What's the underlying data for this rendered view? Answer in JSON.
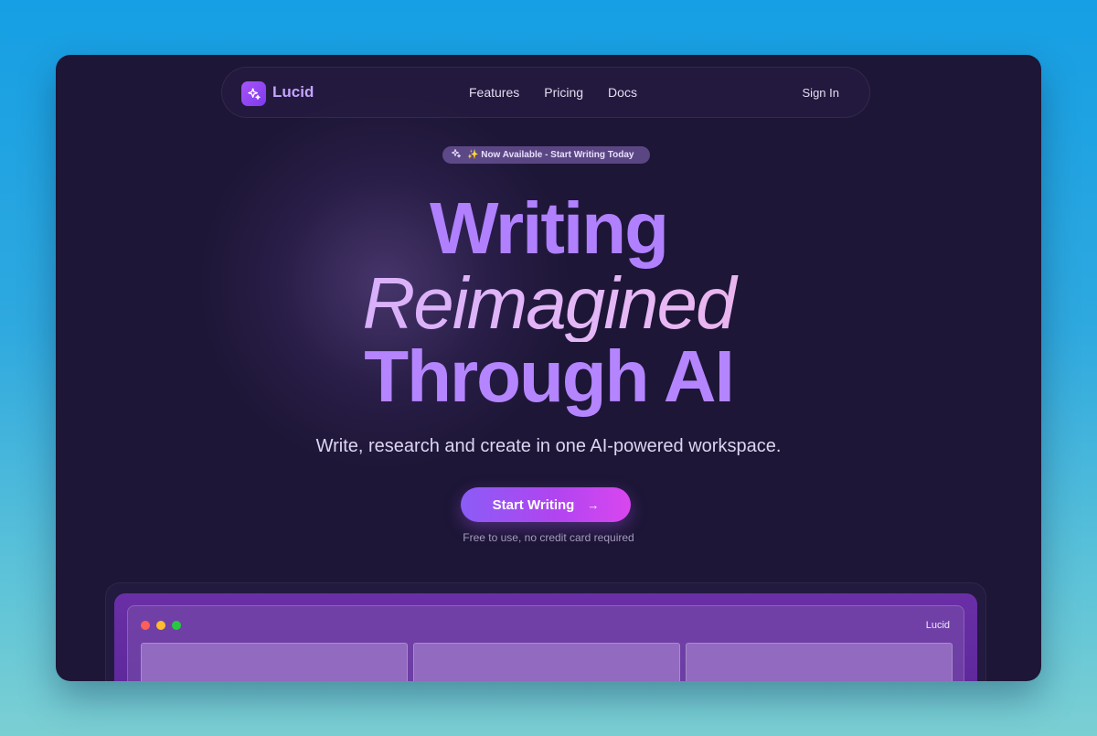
{
  "brand": {
    "name": "Lucid",
    "icon": "sparkles-icon"
  },
  "nav": {
    "links": [
      "Features",
      "Pricing",
      "Docs"
    ],
    "sign_in": "Sign In"
  },
  "badge": {
    "icon": "sparkles-icon",
    "text": "✨ Now Available - Start Writing Today"
  },
  "hero": {
    "line1": "Writing",
    "line2": "Reimagined",
    "line3": "Through AI",
    "subtitle": "Write, research and create in one AI-powered workspace."
  },
  "cta": {
    "label": "Start Writing",
    "arrow": "→",
    "note": "Free to use, no credit card required"
  },
  "preview": {
    "window_title": "Lucid"
  },
  "colors": {
    "accent": "#a855f7",
    "background": "#1d1636",
    "cta_end": "#d946ef"
  }
}
